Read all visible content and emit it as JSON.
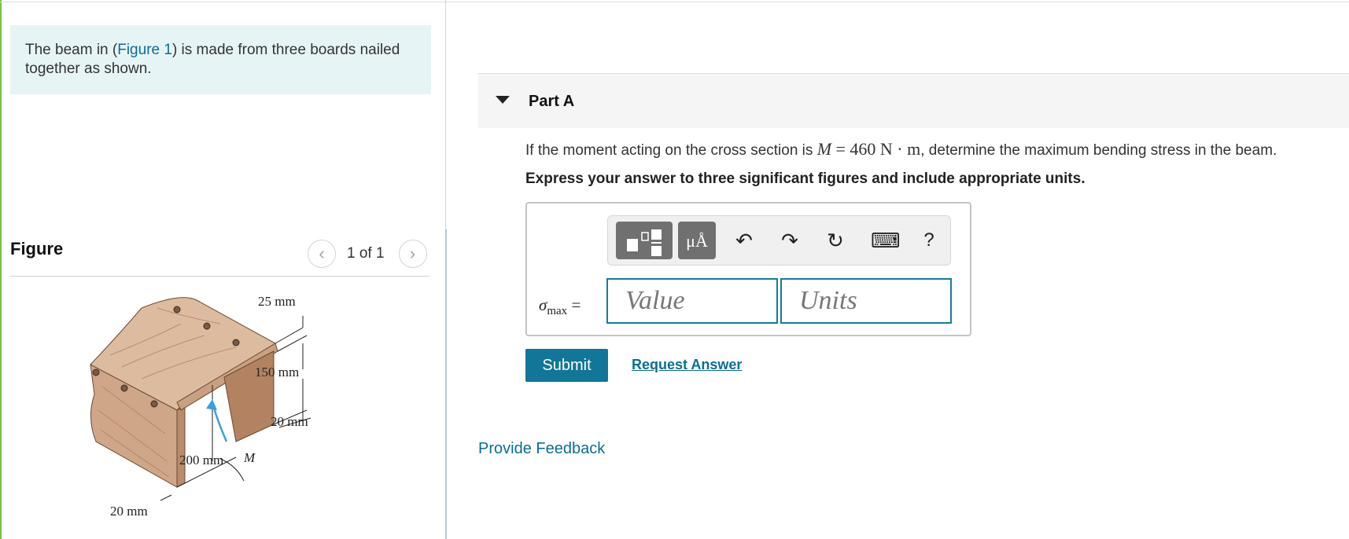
{
  "problem": {
    "intro_prefix": "The beam in (",
    "figure_link": "Figure 1",
    "intro_suffix": ") is made from three boards nailed together as shown."
  },
  "figure_panel": {
    "title": "Figure",
    "pager_text": "1 of 1",
    "labels": {
      "top_thickness": "25 mm",
      "web_height": "150 mm",
      "bottom_gap": "20 mm",
      "width": "200 mm",
      "moment": "M",
      "side_thickness": "20 mm"
    }
  },
  "part": {
    "title": "Part A",
    "question_prefix": "If the moment acting on the cross section is ",
    "question_math_var": "M",
    "question_math_rest": " = 460 N · m",
    "question_suffix": ", determine the maximum bending stress in the beam.",
    "instruction": "Express your answer to three significant figures and include appropriate units."
  },
  "answer": {
    "toolbar": {
      "units_button": "μÅ",
      "undo_icon": "↶",
      "redo_icon": "↷",
      "reset_icon": "↻",
      "keyboard_icon": "⌨",
      "help": "?"
    },
    "label_var": "σ",
    "label_sub": "max",
    "label_eq": " =",
    "value_placeholder": "Value",
    "units_placeholder": "Units"
  },
  "actions": {
    "submit": "Submit",
    "request_answer": "Request Answer",
    "provide_feedback": "Provide Feedback"
  },
  "colors": {
    "accent": "#117697",
    "link": "#0b6e92",
    "intro_bg": "#e6f4f5",
    "wood": "#d9b79a"
  }
}
